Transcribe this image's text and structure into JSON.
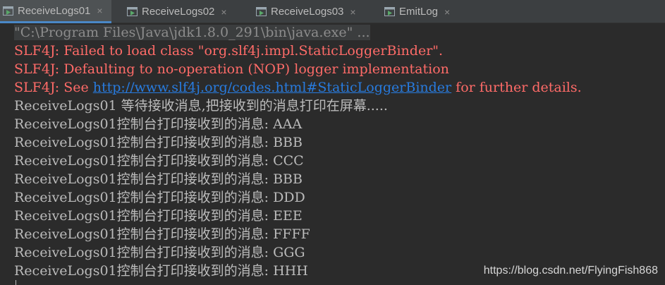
{
  "tabs": [
    {
      "label": "ReceiveLogs01",
      "close": "×",
      "icon": "run-config-icon",
      "active": true
    },
    {
      "label": "ReceiveLogs02",
      "close": "×",
      "icon": "run-config-icon",
      "active": false
    },
    {
      "label": "ReceiveLogs03",
      "close": "×",
      "icon": "run-config-icon",
      "active": false
    },
    {
      "label": "EmitLog",
      "close": "×",
      "icon": "run-config-icon",
      "active": false
    }
  ],
  "console": {
    "command": "\"C:\\Program Files\\Java\\jdk1.8.0_291\\bin\\java.exe\" ...",
    "error_lines": [
      "SLF4J: Failed to load class \"org.slf4j.impl.StaticLoggerBinder\".",
      "SLF4J: Defaulting to no-operation (NOP) logger implementation"
    ],
    "see_line": {
      "prefix": "SLF4J: See ",
      "link": "http://www.slf4j.org/codes.html#StaticLoggerBinder",
      "suffix": " for further details."
    },
    "waiting_line": "ReceiveLogs01 等待接收消息,把接收到的消息打印在屏幕.....",
    "messages": [
      "ReceiveLogs01控制台打印接收到的消息: AAA",
      "ReceiveLogs01控制台打印接收到的消息: BBB",
      "ReceiveLogs01控制台打印接收到的消息: CCC",
      "ReceiveLogs01控制台打印接收到的消息: BBB",
      "ReceiveLogs01控制台打印接收到的消息: DDD",
      "ReceiveLogs01控制台打印接收到的消息: EEE",
      "ReceiveLogs01控制台打印接收到的消息: FFFF",
      "ReceiveLogs01控制台打印接收到的消息: GGG",
      "ReceiveLogs01控制台打印接收到的消息: HHH"
    ]
  },
  "watermark": "https://blog.csdn.net/FlyingFish868",
  "colors": {
    "background": "#2b2b2b",
    "tab_bar": "#3c3f41",
    "active_tab": "#4e5254",
    "active_underline": "#4a88c7",
    "text": "#bbbbbb",
    "error": "#ff6b68",
    "link": "#287bde"
  }
}
